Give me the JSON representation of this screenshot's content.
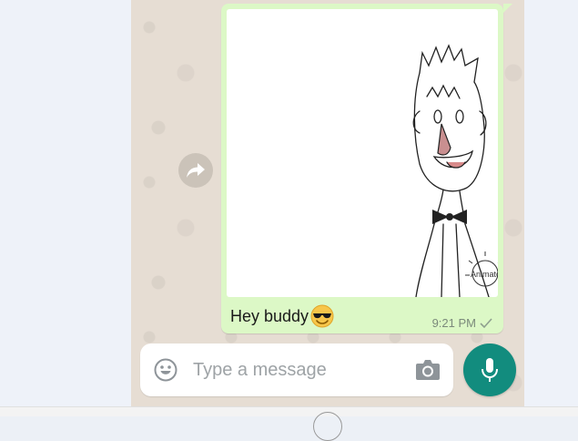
{
  "message": {
    "caption": "Hey buddy",
    "caption_emoji": "smiling-face-with-sunglasses",
    "time": "9:21 PM",
    "status_icon": "single-check-icon",
    "media_watermark": "Animator"
  },
  "composer": {
    "placeholder": "Type a message",
    "emoji_icon": "emoji-icon",
    "camera_icon": "camera-icon",
    "mic_icon": "microphone-icon"
  },
  "colors": {
    "outgoing_bubble": "#dcf8c6",
    "chat_background": "#e6ddd3",
    "accent": "#128c7e"
  }
}
